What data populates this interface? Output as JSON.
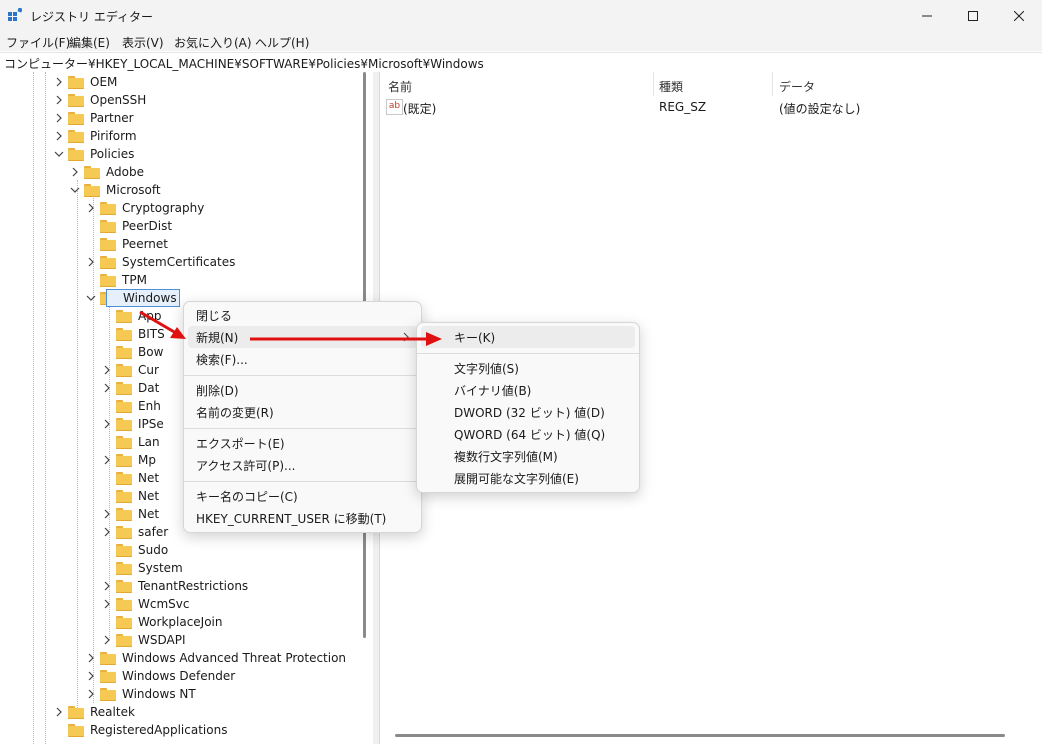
{
  "window": {
    "title": "レジストリ エディター",
    "controls": [
      "minimize-icon",
      "maximize-icon",
      "close-icon"
    ]
  },
  "menubar": {
    "items": [
      "ファイル(F)",
      "編集(E)",
      "表示(V)",
      "お気に入り(A)",
      "ヘルプ(H)"
    ]
  },
  "address": "コンピューター¥HKEY_LOCAL_MACHINE¥SOFTWARE¥Policies¥Microsoft¥Windows",
  "tree": {
    "nodes": [
      {
        "label": "OEM",
        "expander": "closed"
      },
      {
        "label": "OpenSSH",
        "expander": "closed"
      },
      {
        "label": "Partner",
        "expander": "closed"
      },
      {
        "label": "Piriform",
        "expander": "closed"
      },
      {
        "label": "Policies",
        "expander": "open"
      },
      {
        "label": "Adobe",
        "expander": "closed"
      },
      {
        "label": "Microsoft",
        "expander": "open"
      },
      {
        "label": "Cryptography",
        "expander": "closed"
      },
      {
        "label": "PeerDist",
        "expander": "none"
      },
      {
        "label": "Peernet",
        "expander": "none"
      },
      {
        "label": "SystemCertificates",
        "expander": "closed"
      },
      {
        "label": "TPM",
        "expander": "none"
      },
      {
        "label": "Windows",
        "expander": "open",
        "selected": true
      },
      {
        "label": "App",
        "expander": "none"
      },
      {
        "label": "BITS",
        "expander": "none"
      },
      {
        "label": "Bow",
        "expander": "none"
      },
      {
        "label": "Cur",
        "expander": "closed"
      },
      {
        "label": "Dat",
        "expander": "closed"
      },
      {
        "label": "Enh",
        "expander": "none"
      },
      {
        "label": "IPSe",
        "expander": "closed"
      },
      {
        "label": "Lan",
        "expander": "none"
      },
      {
        "label": "Mp",
        "expander": "closed"
      },
      {
        "label": "Net",
        "expander": "none"
      },
      {
        "label": "Net",
        "expander": "none"
      },
      {
        "label": "Net",
        "expander": "closed"
      },
      {
        "label": "safer",
        "expander": "closed"
      },
      {
        "label": "Sudo",
        "expander": "none"
      },
      {
        "label": "System",
        "expander": "none"
      },
      {
        "label": "TenantRestrictions",
        "expander": "closed"
      },
      {
        "label": "WcmSvc",
        "expander": "closed"
      },
      {
        "label": "WorkplaceJoin",
        "expander": "none"
      },
      {
        "label": "WSDAPI",
        "expander": "closed"
      },
      {
        "label": "Windows Advanced Threat Protection",
        "expander": "closed"
      },
      {
        "label": "Windows Defender",
        "expander": "closed"
      },
      {
        "label": "Windows NT",
        "expander": "closed"
      },
      {
        "label": "Realtek",
        "expander": "closed"
      },
      {
        "label": "RegisteredApplications",
        "expander": "none"
      }
    ]
  },
  "list": {
    "columns": [
      "名前",
      "種類",
      "データ"
    ],
    "rows": [
      {
        "name": "(既定)",
        "type": "REG_SZ",
        "data": "(値の設定なし)",
        "icon": "string-value-icon"
      }
    ]
  },
  "context_menu": {
    "items": [
      "閉じる",
      "新規(N)",
      "検索(F)...",
      "削除(D)",
      "名前の変更(R)",
      "エクスポート(E)",
      "アクセス許可(P)...",
      "キー名のコピー(C)",
      "HKEY_CURRENT_USER に移動(T)"
    ]
  },
  "submenu": {
    "items": [
      "キー(K)",
      "文字列値(S)",
      "バイナリ値(B)",
      "DWORD (32 ビット) 値(D)",
      "QWORD (64 ビット) 値(Q)",
      "複数行文字列値(M)",
      "展開可能な文字列値(E)"
    ]
  },
  "colors": {
    "accent": "#4c8fdb",
    "annotation_arrow": "#e01010",
    "folder": "#f6c955"
  }
}
